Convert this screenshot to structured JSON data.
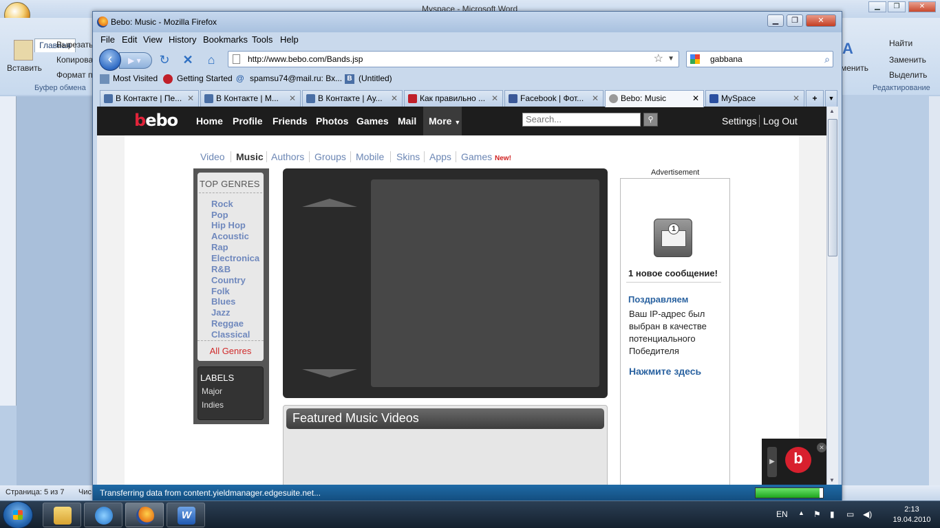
{
  "word": {
    "title": "Myspace - Microsoft Word",
    "tab_home": "Главная",
    "clipboard_cut": "Вырезать",
    "clipboard_copy": "Копирова",
    "clipboard_format": "Формат п",
    "paste": "Вставить",
    "clipboard_group": "Буфер обмена",
    "find": "Найти",
    "replace": "Заменить",
    "select": "Выделить",
    "change": "менить",
    "editing_group": "Редактирование",
    "status_page": "Страница: 5 из 7",
    "status_more": "Чис"
  },
  "firefox": {
    "title": "Bebo: Music - Mozilla Firefox",
    "menu": [
      "File",
      "Edit",
      "View",
      "History",
      "Bookmarks",
      "Tools",
      "Help"
    ],
    "url": "http://www.bebo.com/Bands.jsp",
    "search_value": "gabbana",
    "bookmarks": [
      "Most Visited",
      "Getting Started",
      "spamsu74@mail.ru: Вх...",
      "(Untitled)"
    ],
    "tabs": [
      {
        "label": "В Контакте | Пе...",
        "color": "#4a6fa5"
      },
      {
        "label": "В Контакте | М...",
        "color": "#4a6fa5"
      },
      {
        "label": "В Контакте | Ау...",
        "color": "#4a6fa5"
      },
      {
        "label": "Как правильно ...",
        "color": "#c0202a"
      },
      {
        "label": "Facebook | Фот...",
        "color": "#3b5998"
      },
      {
        "label": "Bebo: Music",
        "color": "#999999"
      },
      {
        "label": "MySpace",
        "color": "#2a4fa0"
      }
    ],
    "new_tab": "+",
    "status_text": "Transferring data from content.yieldmanager.edgesuite.net...",
    "progress_fraction": 0.95
  },
  "bebo": {
    "logo_b": "b",
    "logo_rest": "ebo",
    "nav": [
      "Home",
      "Profile",
      "Friends",
      "Photos",
      "Games",
      "Mail"
    ],
    "more": "More",
    "search_placeholder": "Search...",
    "settings": "Settings",
    "logout": "Log Out",
    "subnav": [
      "Video",
      "Music",
      "Authors",
      "Groups",
      "Mobile",
      "Skins",
      "Apps",
      "Games"
    ],
    "subnav_new": "New!",
    "top_genres_title": "TOP GENRES",
    "genres": [
      "Rock",
      "Pop",
      "Hip Hop",
      "Acoustic",
      "Rap",
      "Electronica",
      "R&B",
      "Country",
      "Folk",
      "Blues",
      "Jazz",
      "Reggae",
      "Classical"
    ],
    "all_genres": "All Genres",
    "labels_title": "LABELS",
    "labels": [
      "Major",
      "Indies"
    ],
    "featured_title": "Featured Music Videos",
    "ad_label": "Advertisement",
    "ad_badge": "1",
    "ad_message": "1 новое сообщение!",
    "ad_congrats": "Поздравляем",
    "ad_body": "Ваш IP-адрес был выбран в качестве потенциального Победителя",
    "ad_click": "Нажмите здесь"
  },
  "taskbar": {
    "lang": "EN",
    "time": "2:13",
    "date": "19.04.2010"
  }
}
